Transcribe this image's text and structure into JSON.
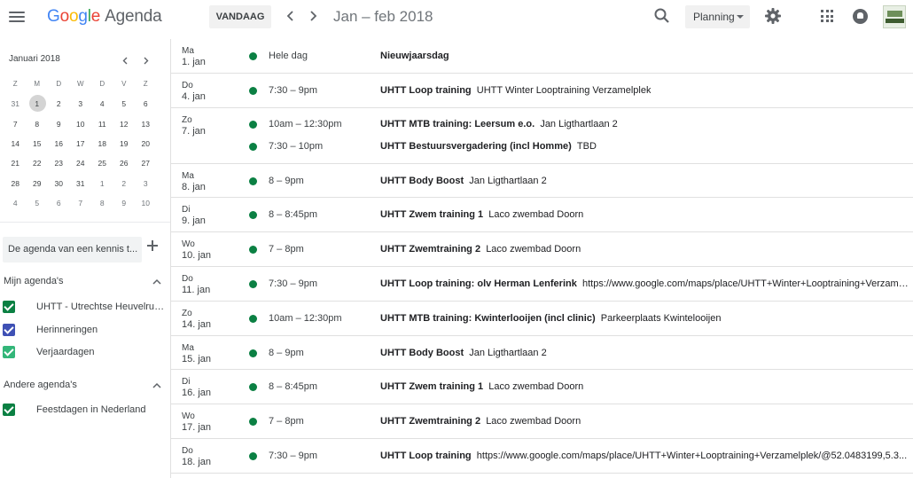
{
  "header": {
    "logo_google": [
      "G",
      "o",
      "o",
      "g",
      "l",
      "e"
    ],
    "logo_app": "Agenda",
    "today_label": "VANDAAG",
    "date_range": "Jan – feb 2018",
    "view_label": "Planning"
  },
  "mini_calendar": {
    "title": "Januari 2018",
    "weekdays": [
      "Z",
      "M",
      "D",
      "W",
      "D",
      "V",
      "Z"
    ],
    "weeks": [
      [
        "31",
        "1",
        "2",
        "3",
        "4",
        "5",
        "6"
      ],
      [
        "7",
        "8",
        "9",
        "10",
        "11",
        "12",
        "13"
      ],
      [
        "14",
        "15",
        "16",
        "17",
        "18",
        "19",
        "20"
      ],
      [
        "21",
        "22",
        "23",
        "24",
        "25",
        "26",
        "27"
      ],
      [
        "28",
        "29",
        "30",
        "31",
        "1",
        "2",
        "3"
      ],
      [
        "4",
        "5",
        "6",
        "7",
        "8",
        "9",
        "10"
      ]
    ],
    "today": "1"
  },
  "sidebar": {
    "lookup_placeholder": "De agenda van een kennis t...",
    "my_calendars_title": "Mijn agenda's",
    "my_calendars": [
      {
        "label": "UHTT - Utrechtse Heuvelrug...",
        "color": "#0b8043"
      },
      {
        "label": "Herinneringen",
        "color": "#3f51b5"
      },
      {
        "label": "Verjaardagen",
        "color": "#33b679"
      }
    ],
    "other_calendars_title": "Andere agenda's",
    "other_calendars": [
      {
        "label": "Feestdagen in Nederland",
        "color": "#0b8043"
      }
    ]
  },
  "days": [
    {
      "weekday": "Ma",
      "date": "1. jan",
      "events": [
        {
          "time": "Hele dag",
          "title": "Nieuwjaarsdag",
          "location": ""
        }
      ]
    },
    {
      "weekday": "Do",
      "date": "4. jan",
      "events": [
        {
          "time": "7:30 – 9pm",
          "title": "UHTT Loop training",
          "location": "UHTT Winter Looptraining Verzamelplek"
        }
      ]
    },
    {
      "weekday": "Zo",
      "date": "7. jan",
      "events": [
        {
          "time": "10am – 12:30pm",
          "title": "UHTT MTB training: Leersum e.o.",
          "location": "Jan Ligthartlaan 2"
        },
        {
          "time": "7:30 – 10pm",
          "title": "UHTT Bestuursvergadering (incl Homme)",
          "location": "TBD"
        }
      ]
    },
    {
      "weekday": "Ma",
      "date": "8. jan",
      "events": [
        {
          "time": "8 – 9pm",
          "title": "UHTT Body Boost",
          "location": "Jan Ligthartlaan 2"
        }
      ]
    },
    {
      "weekday": "Di",
      "date": "9. jan",
      "events": [
        {
          "time": "8 – 8:45pm",
          "title": "UHTT Zwem training 1",
          "location": "Laco zwembad Doorn"
        }
      ]
    },
    {
      "weekday": "Wo",
      "date": "10. jan",
      "events": [
        {
          "time": "7 – 8pm",
          "title": "UHTT Zwemtraining 2",
          "location": "Laco zwembad Doorn"
        }
      ]
    },
    {
      "weekday": "Do",
      "date": "11. jan",
      "events": [
        {
          "time": "7:30 – 9pm",
          "title": "UHTT Loop training: olv Herman Lenferink",
          "location": "https://www.google.com/maps/place/UHTT+Winter+Looptraining+Verzamel..."
        }
      ]
    },
    {
      "weekday": "Zo",
      "date": "14. jan",
      "events": [
        {
          "time": "10am – 12:30pm",
          "title": "UHTT MTB training: Kwinterlooijen (incl clinic)",
          "location": "Parkeerplaats Kwintelooijen"
        }
      ]
    },
    {
      "weekday": "Ma",
      "date": "15. jan",
      "events": [
        {
          "time": "8 – 9pm",
          "title": "UHTT Body Boost",
          "location": "Jan Ligthartlaan 2"
        }
      ]
    },
    {
      "weekday": "Di",
      "date": "16. jan",
      "events": [
        {
          "time": "8 – 8:45pm",
          "title": "UHTT Zwem training 1",
          "location": "Laco zwembad Doorn"
        }
      ]
    },
    {
      "weekday": "Wo",
      "date": "17. jan",
      "events": [
        {
          "time": "7 – 8pm",
          "title": "UHTT Zwemtraining 2",
          "location": "Laco zwembad Doorn"
        }
      ]
    },
    {
      "weekday": "Do",
      "date": "18. jan",
      "events": [
        {
          "time": "7:30 – 9pm",
          "title": "UHTT Loop training",
          "location": "https://www.google.com/maps/place/UHTT+Winter+Looptraining+Verzamelplek/@52.0483199,5.3..."
        }
      ]
    }
  ]
}
